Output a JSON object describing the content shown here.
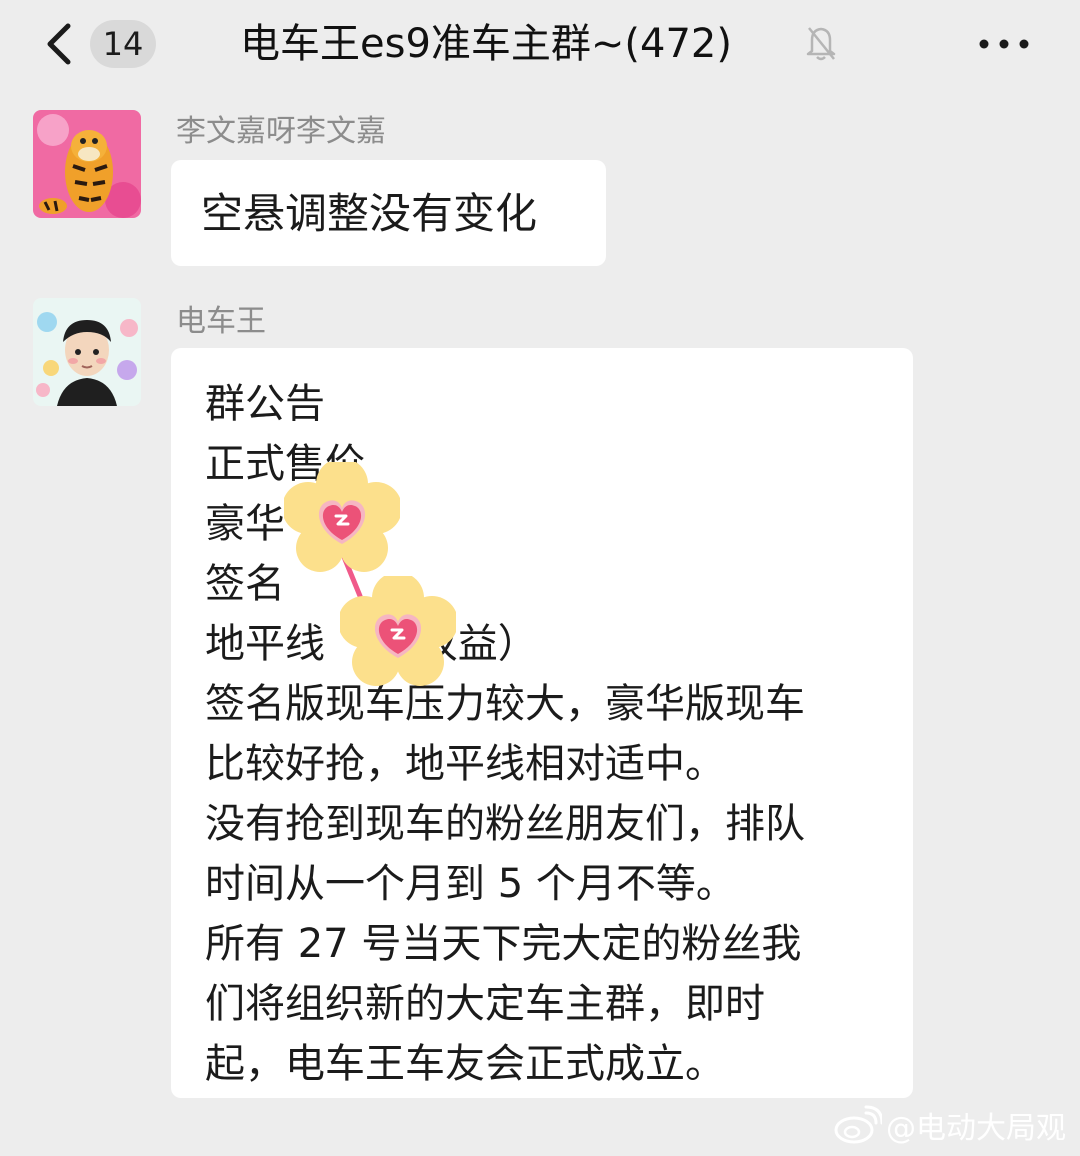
{
  "header": {
    "back_icon": "chevron-left-icon",
    "unread_count": "14",
    "title": "电车王es9准车主群~(472)",
    "mute_icon": "bell-muted-icon",
    "more_icon": "more-horizontal-icon"
  },
  "messages": [
    {
      "sender": "李文嘉呀李文嘉",
      "avatar": "tigger-avatar",
      "text": "空悬调整没有变化"
    },
    {
      "sender": "电车王",
      "avatar": "cartoon-boy-avatar",
      "lines": [
        "群公告",
        "正式售价",
        "豪华",
        "签名",
        "地平线                 （有权益）",
        "签名版现车压力较大，豪华版现车",
        "比较好抢，地平线相对适中。",
        "没有抢到现车的粉丝朋友们，排队",
        "时间从一个月到 5 个月不等。",
        "所有 27 号当天下完大定的粉丝我",
        "们将组织新的大定车主群，即时",
        "起，电车王车友会正式成立。"
      ]
    }
  ],
  "overlay": {
    "sticker_icon": "heart-flower-sticker-icon"
  },
  "watermark": {
    "icon": "weibo-icon",
    "text": "@电动大局观"
  }
}
